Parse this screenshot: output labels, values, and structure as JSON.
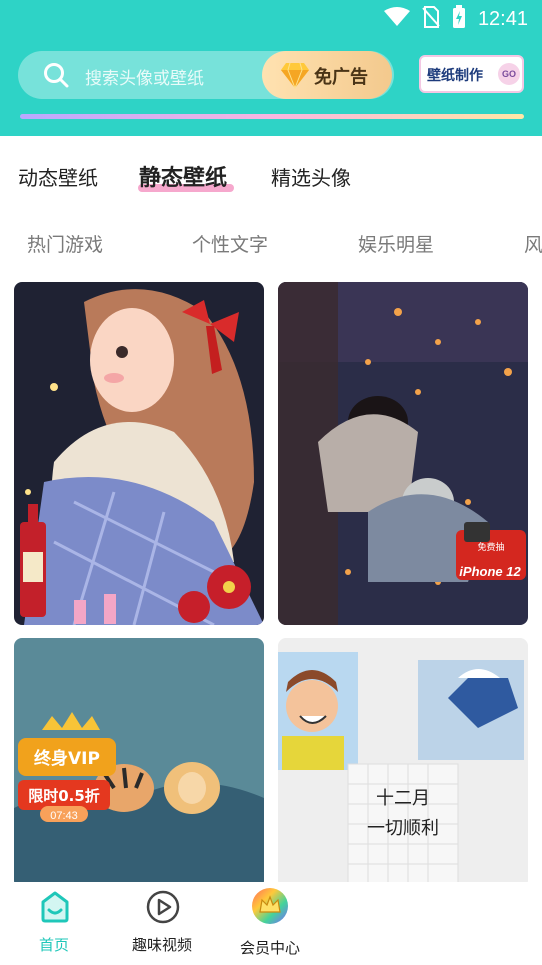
{
  "status_bar": {
    "time": "12:41",
    "icons": [
      "wifi-icon",
      "no-sim-icon",
      "battery-charging-icon"
    ]
  },
  "search": {
    "placeholder": "搜索头像或壁纸",
    "icon": "search-icon"
  },
  "header": {
    "adfree_label": "免广告",
    "adfree_icon": "diamond-icon",
    "make_wallpaper_label": "壁纸制作",
    "make_wallpaper_go": "GO",
    "accent_color": "#2ed3c6"
  },
  "main_tabs": [
    {
      "label": "动态壁纸",
      "active": false
    },
    {
      "label": "静态壁纸",
      "active": true
    },
    {
      "label": "精选头像",
      "active": false
    }
  ],
  "sub_tabs": [
    {
      "label": "热门游戏"
    },
    {
      "label": "个性文字"
    },
    {
      "label": "娱乐明星"
    },
    {
      "label": "风"
    }
  ],
  "cards": [
    {
      "name": "wallpaper-girl-night",
      "badge": ""
    },
    {
      "name": "wallpaper-couple-lanterns",
      "badge_top": "免费抽",
      "badge_main": "iPhone 12"
    },
    {
      "name": "wallpaper-cats-bed",
      "vip_badge": "终身VIP",
      "discount": "限时0.5折",
      "timer": "07:43"
    },
    {
      "name": "wallpaper-peanuts-note",
      "note_text_1": "十二月",
      "note_text_2": "一切顺利"
    }
  ],
  "bottom_nav": [
    {
      "label": "首页",
      "icon": "home-icon",
      "active": true
    },
    {
      "label": "趣味视频",
      "icon": "play-circle-icon",
      "active": false
    },
    {
      "label": "会员中心",
      "icon": "crown-icon",
      "active": false
    }
  ]
}
